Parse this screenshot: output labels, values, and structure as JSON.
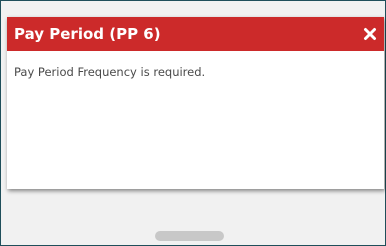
{
  "dialog": {
    "title": "Pay Period (PP 6)",
    "message": "Pay Period Frequency is required.",
    "close_icon": "close-x-icon"
  },
  "colors": {
    "title_bar": "#cc2a2a",
    "title_text": "#ffffff",
    "frame_border": "#1f4e5a",
    "backdrop": "#f1f1f1",
    "scroll_thumb": "#c8c8c8"
  }
}
